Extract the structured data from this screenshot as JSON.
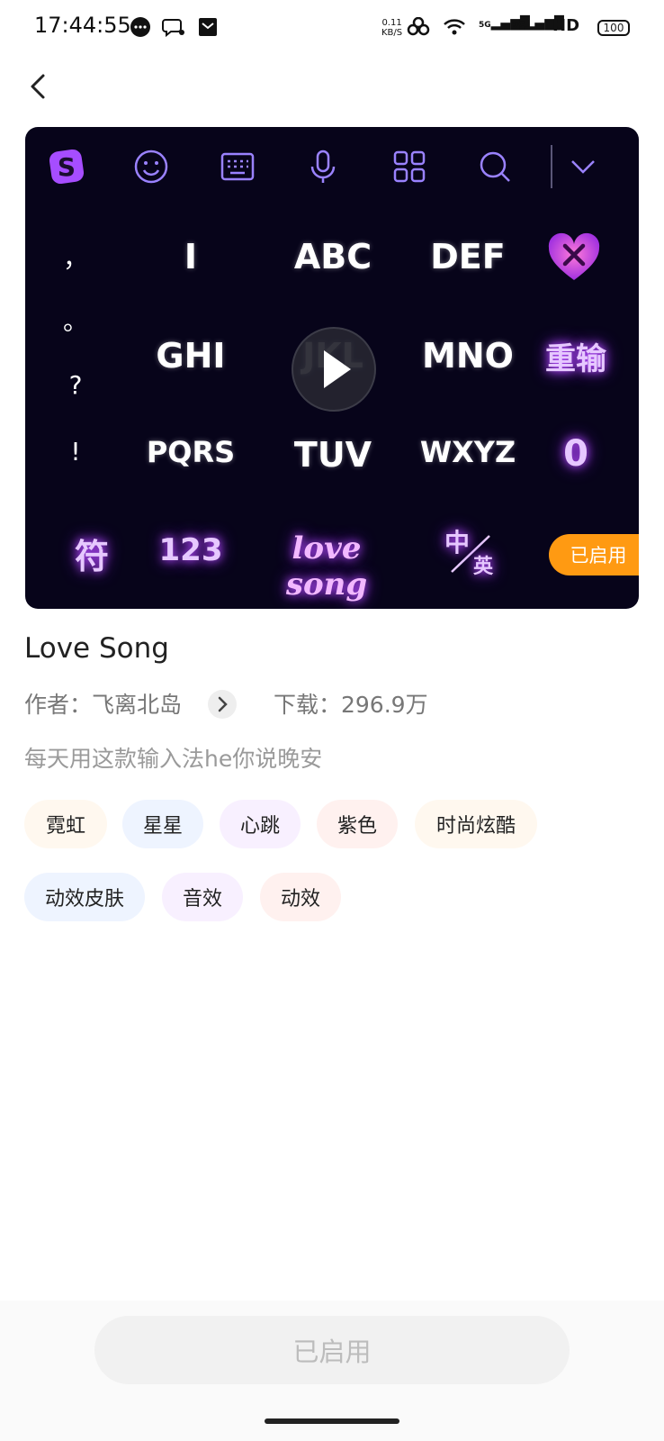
{
  "status_bar": {
    "time": "17:44:55",
    "net_speed": "0.11",
    "net_unit": "KB/S",
    "signal1": "5G",
    "signal2": "5G",
    "hd": "HD",
    "battery": "100"
  },
  "preview": {
    "row1": [
      "I",
      "ABC",
      "DEF"
    ],
    "row2": [
      "GHI",
      "JKL",
      "MNO"
    ],
    "row3": [
      "PQRS",
      "TUV",
      "WXYZ"
    ],
    "punct": [
      "，",
      "。",
      "?",
      "!"
    ],
    "reinput": "重输",
    "zero": "0",
    "symbol": "符",
    "num_key": "123",
    "space": "love song",
    "lang_zh": "中",
    "lang_en": "英",
    "enabled_badge": "已启用"
  },
  "skin": {
    "title": "Love Song",
    "author_label": "作者：飞离北岛",
    "downloads_label": "下载：296.9万",
    "description": "每天用这款输入法he你说晚安"
  },
  "tags": [
    {
      "label": "霓虹",
      "bg": "#fff8ef"
    },
    {
      "label": "星星",
      "bg": "#eef4ff"
    },
    {
      "label": "心跳",
      "bg": "#f8f0ff"
    },
    {
      "label": "紫色",
      "bg": "#fff1ef"
    },
    {
      "label": "时尚炫酷",
      "bg": "#fff8ef"
    },
    {
      "label": "动效皮肤",
      "bg": "#eef4ff"
    },
    {
      "label": "音效",
      "bg": "#f8f0ff"
    },
    {
      "label": "动效",
      "bg": "#fff1ef"
    }
  ],
  "action": {
    "button_label": "已启用"
  },
  "colors": {
    "accent_orange": "#ff9a12",
    "glow_purple": "#b84dff"
  }
}
